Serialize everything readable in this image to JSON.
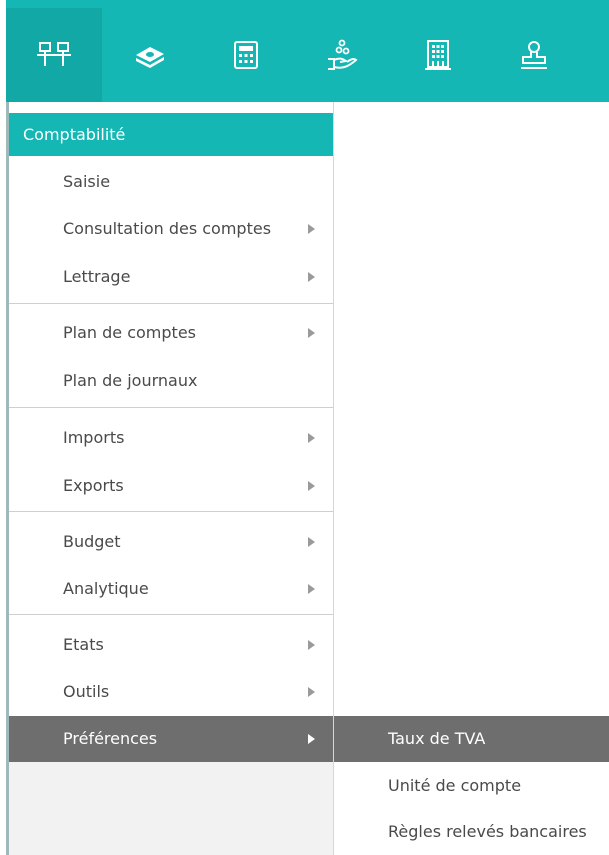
{
  "toolbar": {
    "items": [
      {
        "icon": "org-chart-icon",
        "active": true
      },
      {
        "icon": "money-stack-icon",
        "active": false
      },
      {
        "icon": "calculator-icon",
        "active": false
      },
      {
        "icon": "hand-coins-icon",
        "active": false
      },
      {
        "icon": "building-icon",
        "active": false
      },
      {
        "icon": "stamp-icon",
        "active": false
      }
    ],
    "accent_color": "#14b7b4"
  },
  "menu": {
    "title": "Comptabilité",
    "items": [
      {
        "label": "Saisie",
        "has_submenu": false
      },
      {
        "label": "Consultation des comptes",
        "has_submenu": true
      },
      {
        "label": "Lettrage",
        "has_submenu": true
      },
      {
        "label": "Plan de comptes",
        "has_submenu": true
      },
      {
        "label": "Plan de journaux",
        "has_submenu": false
      },
      {
        "label": "Imports",
        "has_submenu": true
      },
      {
        "label": "Exports",
        "has_submenu": true
      },
      {
        "label": "Budget",
        "has_submenu": true
      },
      {
        "label": "Analytique",
        "has_submenu": true
      },
      {
        "label": "Etats",
        "has_submenu": true
      },
      {
        "label": "Outils",
        "has_submenu": true
      },
      {
        "label": "Préférences",
        "has_submenu": true,
        "selected": true
      }
    ],
    "selected_color": "#6e6e6e"
  },
  "submenu": {
    "items": [
      {
        "label": "Taux de TVA",
        "selected": true
      },
      {
        "label": "Unité de compte"
      },
      {
        "label": "Règles relevés bancaires"
      }
    ]
  }
}
